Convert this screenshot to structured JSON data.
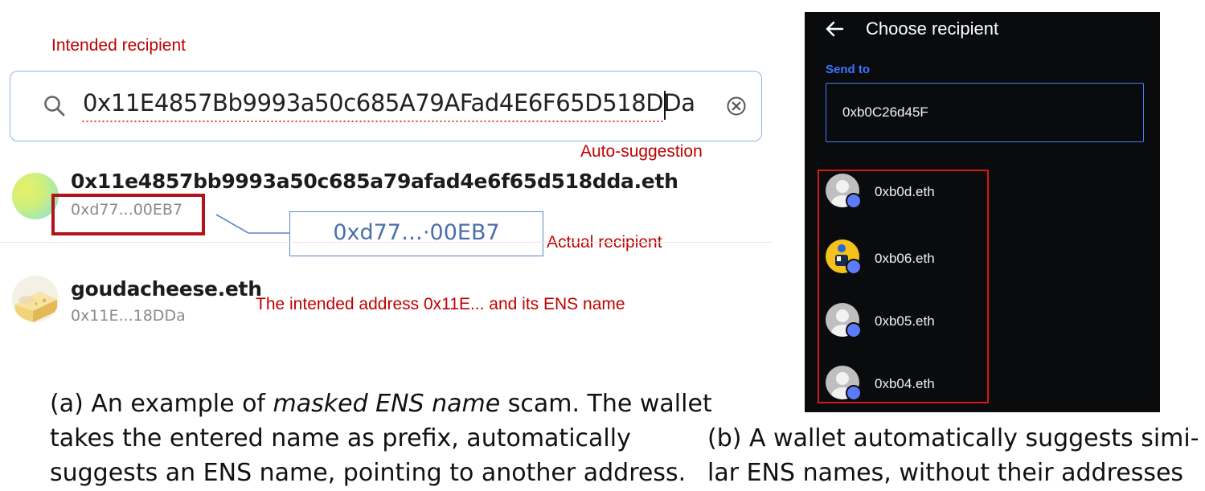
{
  "panel_a": {
    "annotation_intended": "Intended recipient",
    "search": {
      "value": "0x11E4857Bb9993a50c685A79AFad4E6F65D518DDa"
    },
    "annotation_autosuggestion": "Auto-suggestion",
    "suggestion": {
      "name": "0x11e4857bb9993a50c685a79afad4e6f65d518dda.eth",
      "address": "0xd77...00EB7"
    },
    "callout_address": "0xd77…·00EB7",
    "annotation_actual": "Actual recipient",
    "second_result": {
      "name": "goudacheese.eth",
      "address": "0x11E...18DDa"
    },
    "annotation_intended_address": "The intended address 0x11E... and its ENS name",
    "caption": {
      "line1_prefix": "(a) An example of ",
      "line1_italic": "masked ENS name",
      "line1_suffix": " scam. The wallet",
      "line2": "takes the entered name as prefix, automatically",
      "line3": "suggests an ENS name, pointing to another address."
    }
  },
  "panel_b": {
    "title": "Choose recipient",
    "send_to_label": "Send to",
    "input_value": "0xb0C26d45F",
    "items": [
      {
        "label": "0xb0d.eth",
        "avatar": "default-avatar-icon"
      },
      {
        "label": "0xb06.eth",
        "avatar": "person-yellow-avatar-icon"
      },
      {
        "label": "0xb05.eth",
        "avatar": "default-avatar-icon"
      },
      {
        "label": "0xb04.eth",
        "avatar": "default-avatar-icon"
      }
    ],
    "caption": {
      "line1": "(b) A wallet automatically suggests simi-",
      "line2": "lar ENS names, without their addresses"
    }
  },
  "colors": {
    "annotation_red": "#c00000",
    "frame_red": "#b4121b",
    "callout_blue": "#5b86c5",
    "wallet_accent_blue": "#3b76ff",
    "dark_bg": "#0a0b0d"
  }
}
